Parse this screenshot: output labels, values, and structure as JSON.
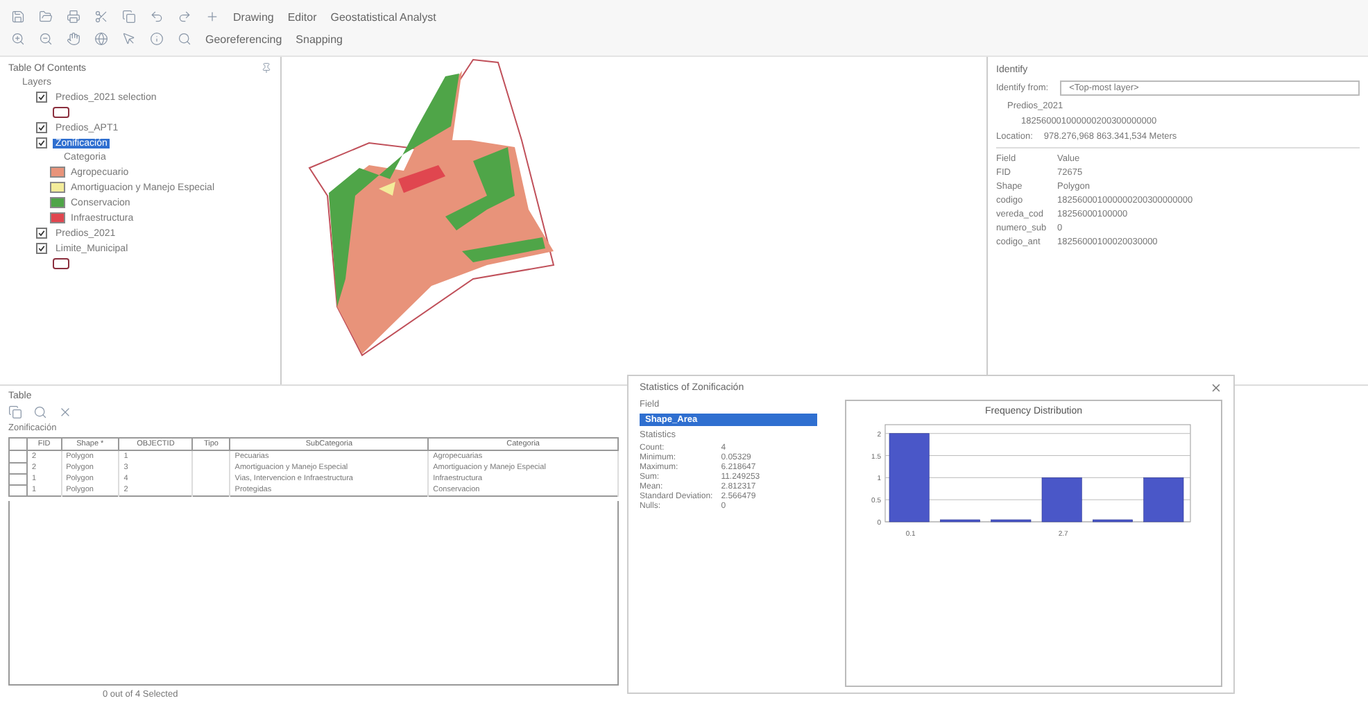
{
  "toolbar": {
    "rows": [
      [
        {
          "kind": "text",
          "label": "Drawing"
        },
        {
          "kind": "text",
          "label": "Editor"
        },
        {
          "kind": "text",
          "label": "Geostatistical Analyst"
        }
      ],
      [
        {
          "kind": "text",
          "label": "Georeferencing"
        },
        {
          "kind": "text",
          "label": "Snapping"
        }
      ]
    ]
  },
  "toc": {
    "title": "Table Of Contents",
    "root": "Layers",
    "layers": [
      {
        "label": "Predios_2021 selection",
        "checked": true,
        "selected": false,
        "outline_symbol": true
      },
      {
        "label": "Predios_APT1",
        "checked": true,
        "selected": false
      },
      {
        "label": "Zonificación",
        "checked": true,
        "selected": true,
        "heading": "Categoria",
        "legend": [
          {
            "label": "Agropecuario",
            "color": "#e8937a"
          },
          {
            "label": "Amortiguacion y Manejo Especial",
            "color": "#f3ec9a"
          },
          {
            "label": "Conservacion",
            "color": "#4fa548"
          },
          {
            "label": "Infraestructura",
            "color": "#e0464f"
          }
        ]
      },
      {
        "label": "Predios_2021",
        "checked": true,
        "selected": false
      },
      {
        "label": "Limite_Municipal",
        "checked": true,
        "selected": false,
        "outline_symbol": true
      }
    ]
  },
  "identify": {
    "title": "Identify",
    "from_label": "Identify from:",
    "from_value": "<Top-most layer>",
    "layer": "Predios_2021",
    "feature": "182560001000000200300000000",
    "location_label": "Location:",
    "location_value": "978.276,968 863.341,534 Meters",
    "columns": [
      "Field",
      "Value"
    ],
    "rows": [
      [
        "FID",
        "72675"
      ],
      [
        "Shape",
        "Polygon"
      ],
      [
        "codigo",
        "182560001000000200300000000"
      ],
      [
        "vereda_cod",
        "18256000100000"
      ],
      [
        "numero_sub",
        "0"
      ],
      [
        "codigo_ant",
        "18256000100020030000"
      ]
    ]
  },
  "table": {
    "title": "Table",
    "layer_tab": "Zonificación",
    "columns": [
      "FID",
      "Shape *",
      "OBJECTID",
      "Tipo",
      "SubCategoria",
      "Categoria"
    ],
    "rows": [
      [
        "2",
        "Polygon",
        "1",
        "",
        "Pecuarias",
        "Agropecuarias"
      ],
      [
        "2",
        "Polygon",
        "3",
        "",
        "Amortiguacion y Manejo Especial",
        "Amortiguacion y Manejo Especial"
      ],
      [
        "1",
        "Polygon",
        "4",
        "",
        "Vias, Intervencion e Infraestructura",
        "Infraestructura"
      ],
      [
        "1",
        "Polygon",
        "2",
        "",
        "Protegidas",
        "Conservacion"
      ]
    ],
    "status": "0 out of 4 Selected"
  },
  "statistics": {
    "title": "Statistics of Zonificación",
    "field_label": "Field",
    "field_value": "Shape_Area",
    "stats_label": "Statistics",
    "stats": [
      [
        "Count:",
        "4"
      ],
      [
        "Minimum:",
        "0.05329"
      ],
      [
        "Maximum:",
        "6.218647"
      ],
      [
        "Sum:",
        "11.249253"
      ],
      [
        "Mean:",
        "2.812317"
      ],
      [
        "Standard Deviation:",
        "2.566479"
      ],
      [
        "Nulls:",
        "0"
      ]
    ],
    "chart_data": {
      "type": "bar",
      "title": "Frequency Distribution",
      "categories": [
        "0.1",
        null,
        null,
        "2.7",
        null,
        null
      ],
      "values": [
        2,
        0,
        0,
        1,
        0,
        1
      ],
      "grid": true,
      "ylim": [
        0,
        2.2
      ],
      "yticks": [
        0,
        0.5,
        1,
        1.5,
        2
      ]
    }
  }
}
